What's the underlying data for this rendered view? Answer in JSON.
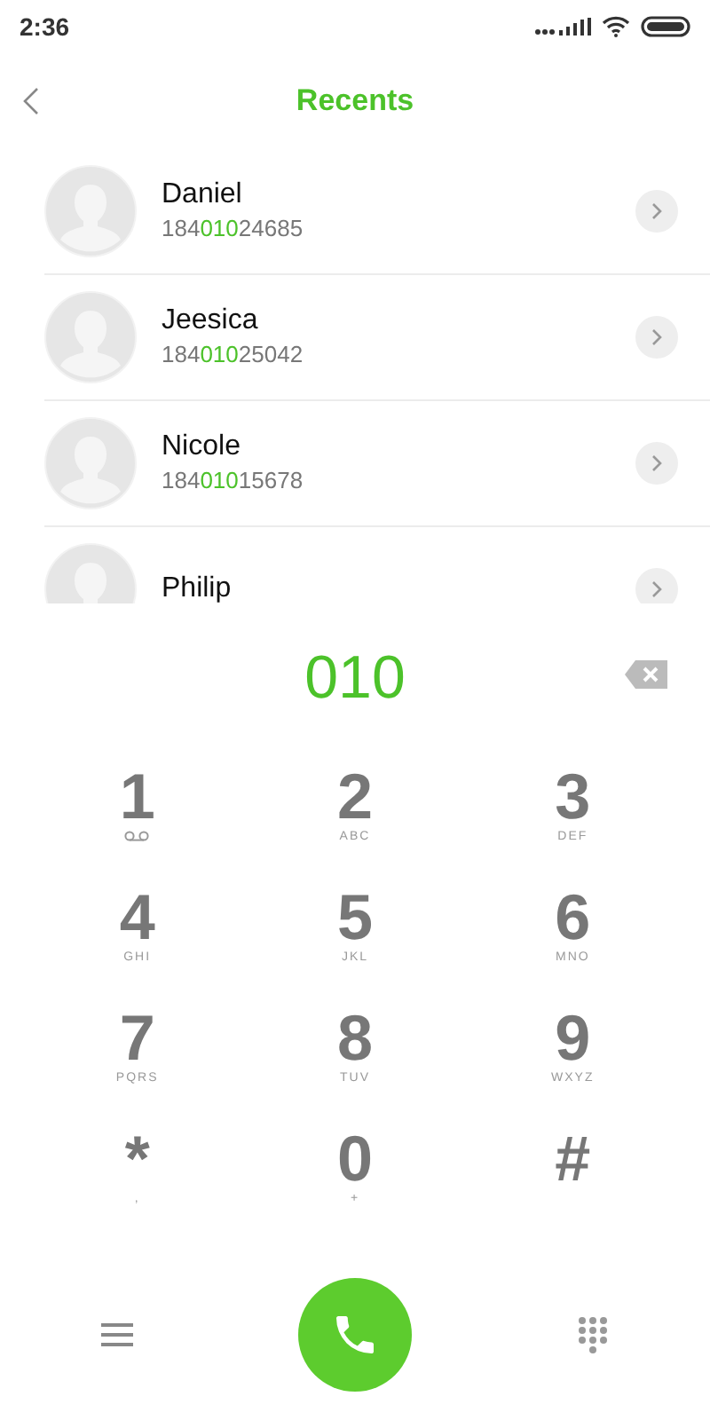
{
  "status_bar": {
    "time": "2:36"
  },
  "header": {
    "title": "Recents"
  },
  "contacts": [
    {
      "name": "Daniel",
      "number_parts": [
        "184",
        "010",
        "24685"
      ]
    },
    {
      "name": "Jeesica",
      "number_parts": [
        "184",
        "010",
        "25042"
      ]
    },
    {
      "name": "Nicole",
      "number_parts": [
        "184",
        "010",
        "15678"
      ]
    },
    {
      "name": "Philip"
    }
  ],
  "dialed": "010",
  "keys": [
    {
      "digit": "1",
      "kind": "voicemail"
    },
    {
      "digit": "2",
      "kind": "letters",
      "sub": "ABC"
    },
    {
      "digit": "3",
      "kind": "letters",
      "sub": "DEF"
    },
    {
      "digit": "4",
      "kind": "letters",
      "sub": "GHI"
    },
    {
      "digit": "5",
      "kind": "letters",
      "sub": "JKL"
    },
    {
      "digit": "6",
      "kind": "letters",
      "sub": "MNO"
    },
    {
      "digit": "7",
      "kind": "letters",
      "sub": "PQRS"
    },
    {
      "digit": "8",
      "kind": "letters",
      "sub": "TUV"
    },
    {
      "digit": "9",
      "kind": "letters",
      "sub": "WXYZ"
    },
    {
      "digit": "*",
      "kind": "letters",
      "sub": ","
    },
    {
      "digit": "0",
      "kind": "letters",
      "sub": "+"
    },
    {
      "digit": "#",
      "kind": "plain"
    }
  ]
}
